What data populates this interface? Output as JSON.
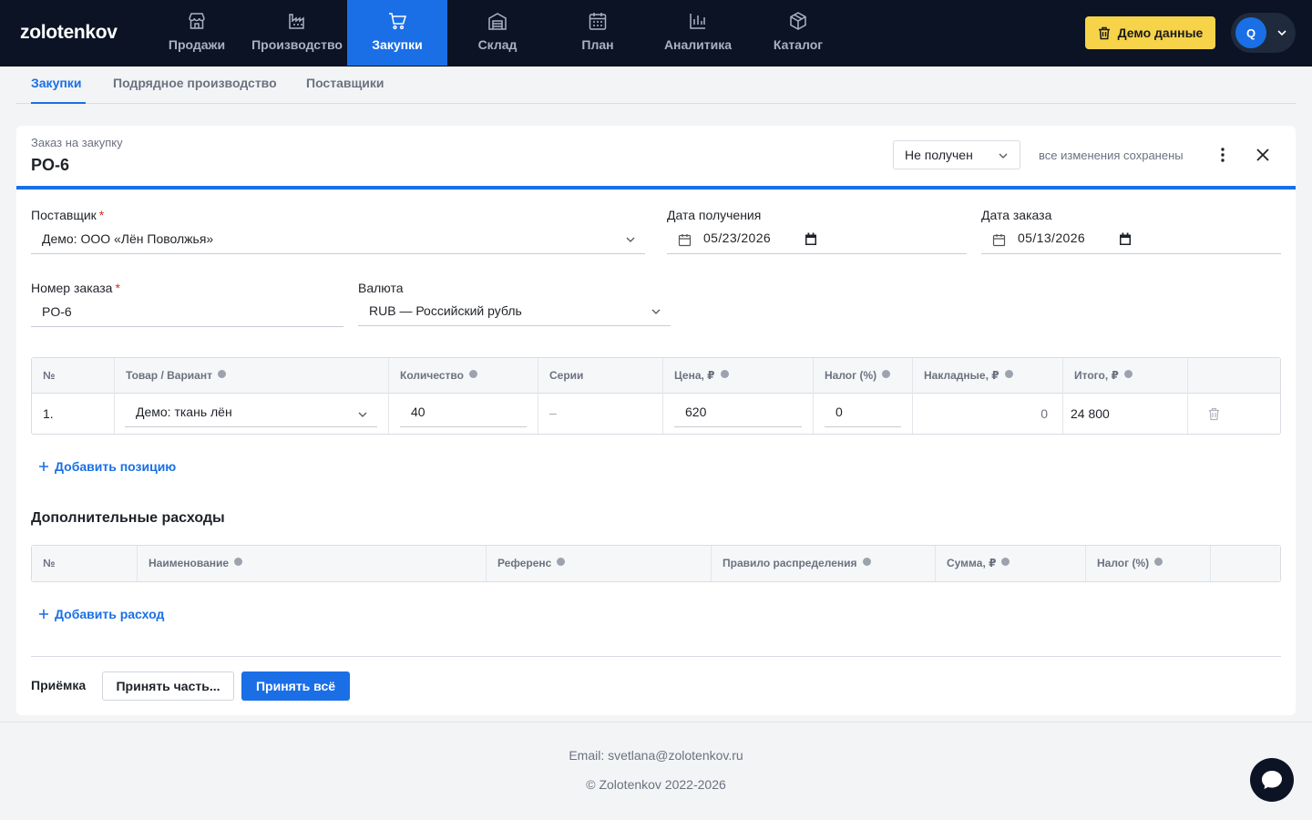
{
  "brand": {
    "logo": "zolotenkov"
  },
  "nav": {
    "items": [
      {
        "label": "Продажи",
        "icon": "store-icon"
      },
      {
        "label": "Производство",
        "icon": "factory-icon"
      },
      {
        "label": "Закупки",
        "icon": "cart-icon",
        "active": true
      },
      {
        "label": "Склад",
        "icon": "warehouse-icon"
      },
      {
        "label": "План",
        "icon": "calendar-icon"
      },
      {
        "label": "Аналитика",
        "icon": "bar-chart-icon"
      },
      {
        "label": "Каталог",
        "icon": "box-icon"
      }
    ],
    "demo_button": "Демо данные",
    "avatar_initial": "Q"
  },
  "subtabs": {
    "items": [
      "Закупки",
      "Подрядное производство",
      "Поставщики"
    ],
    "active": "Закупки"
  },
  "order": {
    "kind": "Заказ на закупку",
    "number": "PO-6",
    "status": "Не получен",
    "saved_text": "все изменения сохранены",
    "accent": "#1a6fe6"
  },
  "form": {
    "supplier": {
      "label": "Поставщик",
      "value": "Демо: ООО «Лён Поволжья»"
    },
    "receive_date": {
      "label": "Дата получения",
      "value": "05/23/2026"
    },
    "order_date": {
      "label": "Дата заказа",
      "value": "05/13/2026"
    },
    "order_number": {
      "label": "Номер заказа",
      "value": "PO-6"
    },
    "currency": {
      "label": "Валюта",
      "value": "RUB — Российский рубль"
    }
  },
  "lines_table": {
    "headers": [
      "№",
      "Товар / Вариант",
      "Количество",
      "Серии",
      "Цена, ₽",
      "Налог (%)",
      "Накладные, ₽",
      "Итого, ₽"
    ],
    "rows": [
      {
        "num": "1.",
        "product": "Демо: ткань лён",
        "qty": "40",
        "series": "–",
        "price": "620",
        "tax": "0",
        "overhead": "0",
        "total": "24 800"
      }
    ],
    "add_label": "Добавить позицию"
  },
  "expenses": {
    "title": "Дополнительные расходы",
    "headers": [
      "№",
      "Наименование",
      "Референс",
      "Правило распределения",
      "Сумма, ₽",
      "Налог (%)"
    ],
    "add_label": "Добавить расход"
  },
  "reception": {
    "label": "Приёмка",
    "partial_button": "Принять часть...",
    "all_button": "Принять всё"
  },
  "footer": {
    "email": "Email: svetlana@zolotenkov.ru",
    "copyright": "© Zolotenkov 2022-2026"
  }
}
